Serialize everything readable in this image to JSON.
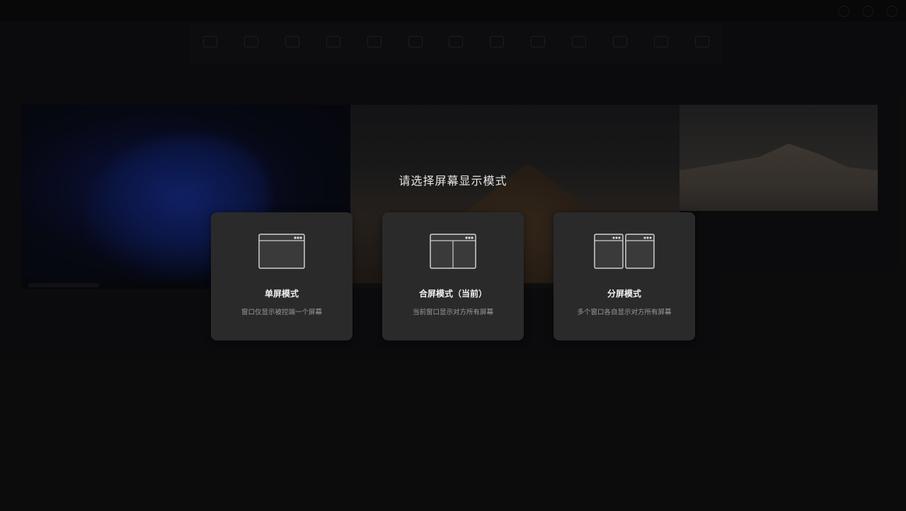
{
  "window": {
    "title": "",
    "controls": [
      "minimize-icon",
      "maximize-icon",
      "close-icon"
    ]
  },
  "toolbar": {
    "items": [
      {
        "icon": "remote-icon",
        "label": ""
      },
      {
        "icon": "monitor-icon",
        "label": ""
      },
      {
        "icon": "grid-icon",
        "label": ""
      },
      {
        "icon": "share-icon",
        "label": ""
      },
      {
        "icon": "refresh-icon",
        "label": ""
      },
      {
        "icon": "file-icon",
        "label": ""
      },
      {
        "icon": "screen-icon",
        "label": ""
      },
      {
        "icon": "display-icon",
        "label": ""
      },
      {
        "icon": "camera-icon",
        "label": ""
      },
      {
        "icon": "close-icon",
        "label": ""
      },
      {
        "icon": "more-icon",
        "label": ""
      },
      {
        "icon": "settings-icon",
        "label": ""
      },
      {
        "icon": "help-icon",
        "label": ""
      }
    ]
  },
  "dialog": {
    "prompt": "请选择屏幕显示模式",
    "options": [
      {
        "id": "single",
        "icon": "single-window-icon",
        "title": "单屏模式",
        "description": "窗口仅显示被控端一个屏幕"
      },
      {
        "id": "merged",
        "icon": "merged-window-icon",
        "title": "合屏模式（当前）",
        "description": "当前窗口显示对方所有屏幕"
      },
      {
        "id": "split",
        "icon": "split-window-icon",
        "title": "分屏模式",
        "description": "多个窗口各自显示对方所有屏幕"
      }
    ]
  },
  "colors": {
    "background": "#0d0d0e",
    "card": "#2a2a2b",
    "title_text": "#f0f0f0",
    "desc_text": "#9a9a9a"
  }
}
